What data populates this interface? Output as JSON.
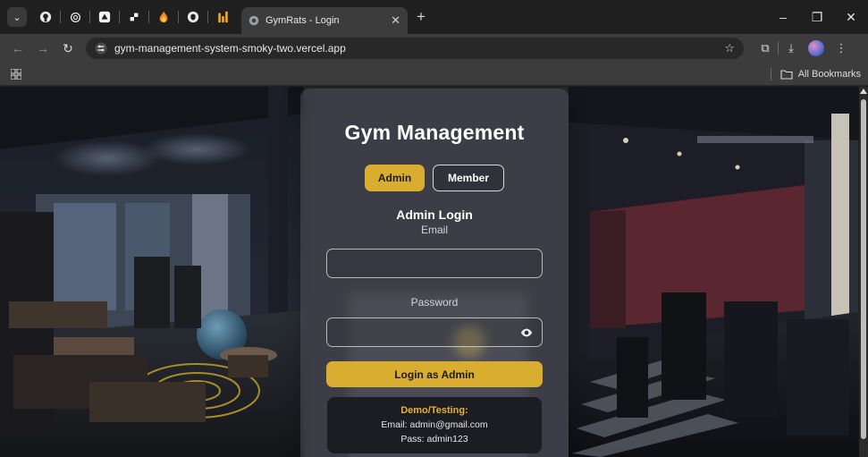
{
  "browser": {
    "tab_title": "GymRats - Login",
    "url": "gym-management-system-smoky-two.vercel.app",
    "bookmarks_label": "All Bookmarks"
  },
  "login": {
    "title": "Gym Management",
    "roles": {
      "admin": "Admin",
      "member": "Member"
    },
    "heading": "Admin Login",
    "email_label": "Email",
    "email_value": "",
    "password_label": "Password",
    "password_value": "",
    "submit_label": "Login as Admin",
    "demo": {
      "heading": "Demo/Testing:",
      "email_line": "Email: admin@gmail.com",
      "pass_line": "Pass: admin123"
    }
  },
  "colors": {
    "accent": "#d9ad2f",
    "demo_heading": "#e5b13a",
    "chrome_dark": "#1f1f1f",
    "chrome_light": "#3c3c3c"
  }
}
